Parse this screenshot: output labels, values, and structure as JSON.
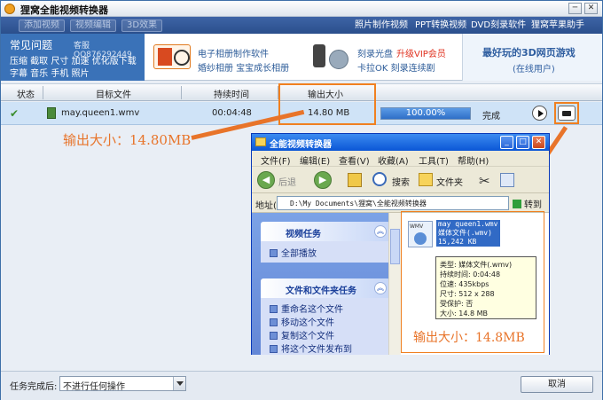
{
  "window": {
    "title": "狸窝全能视频转换器",
    "controls": [
      "─",
      "✕"
    ]
  },
  "menubar": {
    "left_buttons": [
      "添加视频",
      "视频编辑",
      "3D效果"
    ],
    "right_links": [
      "照片制作视频",
      "PPT转换视频",
      "DVD刻录软件",
      "狸窝苹果助手"
    ]
  },
  "banner": {
    "faq_title": "常见问题",
    "qq": "客服QQ876292449",
    "faq_row1": "压缩 截取 尺寸 加速 优化版下载",
    "faq_row2": "字幕 音乐 手机 照片",
    "ad1_line1": "电子相册制作软件",
    "ad1_line2": "婚纱相册 宝宝成长相册",
    "ad2_line1": "刻录光盘",
    "ad2_vip": "升级VIP会员",
    "ad2_line2": "卡拉OK 刻录连续剧",
    "ad3_line1": "最好玩的3D网页游戏",
    "ad3_line2": "(在线用户)"
  },
  "table": {
    "headers": [
      "状态",
      "目标文件",
      "持续时间",
      "输出大小"
    ],
    "row": {
      "status_icon": "check-icon",
      "status_glyph": "✔",
      "file": "may.queen1.wmv",
      "duration": "00:04:48",
      "size": "14.80 MB",
      "progress_text": "100.00%",
      "progress_fraction": 1.0,
      "state": "完成"
    }
  },
  "annotations": {
    "left_label": "输出大小：14.80MB",
    "right_label": "输出大小：14.8MB",
    "color": "#e8742a"
  },
  "bottom": {
    "after_label": "任务完成后:",
    "after_value": "不进行任何操作",
    "cancel": "取消"
  },
  "explorer": {
    "title": "全能视频转换器",
    "controls": [
      "_",
      "□",
      "✕"
    ],
    "menu": [
      "文件(F)",
      "编辑(E)",
      "查看(V)",
      "收藏(A)",
      "工具(T)",
      "帮助(H)"
    ],
    "back": "后退",
    "search": "搜索",
    "folders": "文件夹",
    "address_label": "地址(D)",
    "address": "D:\\My Documents\\狸窝\\全能视频转换器",
    "go": "转到",
    "video_tasks_title": "视频任务",
    "video_tasks": [
      "全部播放"
    ],
    "file_tasks_title": "文件和文件夹任务",
    "file_tasks": [
      "重命名这个文件",
      "移动这个文件",
      "复制这个文件",
      "将这个文件发布到"
    ],
    "file_icon_label": "WMV",
    "file_name_lines": [
      "may queen1.wmv",
      "媒体文件(.wmv)",
      "15,242 KB"
    ],
    "tooltip": [
      "类型: 媒体文件(.wmv)",
      "持续时间: 0:04:48",
      "位速: 435kbps",
      "尺寸: 512 x 288",
      "受保护: 否",
      "大小: 14.8 MB"
    ],
    "accent": "#0b56d6"
  }
}
